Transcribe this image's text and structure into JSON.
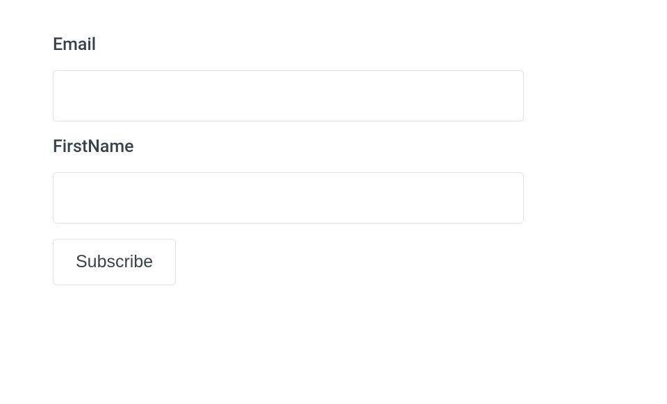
{
  "form": {
    "email": {
      "label": "Email",
      "value": ""
    },
    "firstname": {
      "label": "FirstName",
      "value": ""
    },
    "submit_label": "Subscribe"
  }
}
